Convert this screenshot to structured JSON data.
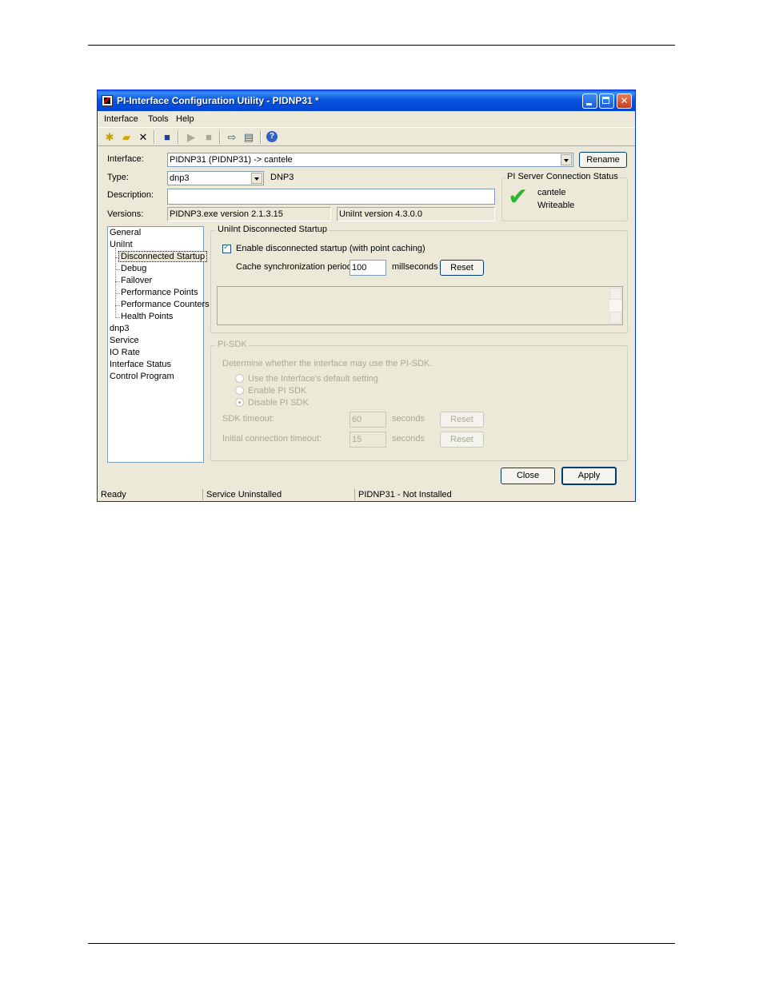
{
  "window": {
    "title": "PI-Interface Configuration Utility - PIDNP31  *"
  },
  "menu": [
    "Interface",
    "Tools",
    "Help"
  ],
  "toolbar": {
    "icons": [
      "new-icon",
      "open-icon",
      "delete-icon",
      "save-icon",
      "start-icon",
      "stop-icon",
      "export-icon",
      "batch-icon",
      "help-icon"
    ]
  },
  "form": {
    "interface_label": "Interface:",
    "interface_value": "PIDNP31 (PIDNP31) -> cantele",
    "rename_label": "Rename",
    "type_label": "Type:",
    "type_value": "dnp3",
    "type_desc": "DNP3",
    "description_label": "Description:",
    "description_value": "",
    "versions_label": "Versions:",
    "version_exe": "PIDNP3.exe version 2.1.3.15",
    "version_uniint": "UniInt version 4.3.0.0"
  },
  "server_status": {
    "title": "PI Server Connection Status",
    "server": "cantele",
    "access": "Writeable"
  },
  "tree": {
    "items": [
      {
        "label": "General"
      },
      {
        "label": "UniInt"
      },
      {
        "label": "Disconnected Startup"
      },
      {
        "label": "Debug"
      },
      {
        "label": "Failover"
      },
      {
        "label": "Performance Points"
      },
      {
        "label": "Performance Counters"
      },
      {
        "label": "Health Points"
      },
      {
        "label": "dnp3"
      },
      {
        "label": "Service"
      },
      {
        "label": "IO Rate"
      },
      {
        "label": "Interface Status"
      },
      {
        "label": "Control Program"
      }
    ]
  },
  "disconnected": {
    "title": "UniInt Disconnected Startup",
    "enable_label": "Enable disconnected startup (with point caching)",
    "cache_label": "Cache synchronization period:",
    "cache_value": "100",
    "cache_unit": "millseconds",
    "reset_label": "Reset"
  },
  "pisdk": {
    "title": "PI-SDK",
    "question": "Determine whether the interface may use the PI-SDK.",
    "options": [
      "Use the Interface's default setting",
      "Enable PI SDK",
      "Disable PI SDK"
    ],
    "sdk_timeout_label": "SDK timeout:",
    "sdk_timeout_value": "60",
    "sdk_timeout_unit": "seconds",
    "init_timeout_label": "Initial connection timeout:",
    "init_timeout_value": "15",
    "init_timeout_unit": "seconds",
    "reset_label": "Reset"
  },
  "buttons": {
    "close": "Close",
    "apply": "Apply"
  },
  "status": [
    "Ready",
    "Service Uninstalled",
    "PIDNP31 - Not Installed"
  ]
}
